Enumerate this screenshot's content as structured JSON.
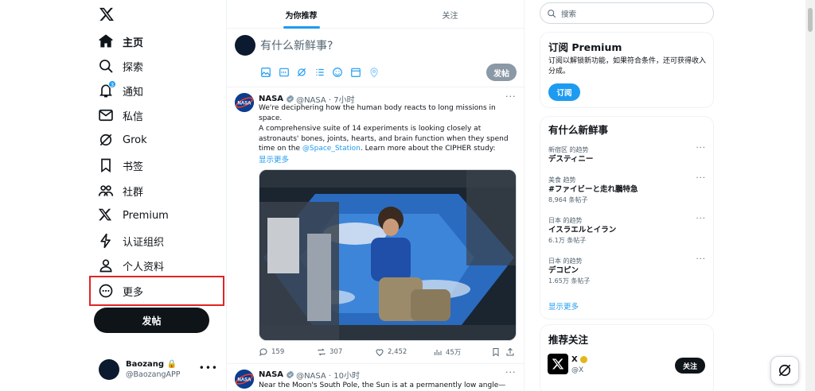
{
  "nav": {
    "items": [
      {
        "label": "主页",
        "icon": "home-icon"
      },
      {
        "label": "探索",
        "icon": "search-icon"
      },
      {
        "label": "通知",
        "icon": "bell-icon",
        "badge": "3"
      },
      {
        "label": "私信",
        "icon": "mail-icon"
      },
      {
        "label": "Grok",
        "icon": "grok-icon"
      },
      {
        "label": "书签",
        "icon": "bookmark-icon"
      },
      {
        "label": "社群",
        "icon": "communities-icon"
      },
      {
        "label": "Premium",
        "icon": "x-logo-icon"
      },
      {
        "label": "认证组织",
        "icon": "lightning-icon"
      },
      {
        "label": "个人资料",
        "icon": "profile-icon"
      },
      {
        "label": "更多",
        "icon": "more-circle-icon"
      }
    ],
    "post_button": "发帖",
    "account": {
      "name": "Baozang",
      "handle": "@BaozangAPP"
    }
  },
  "main": {
    "tabs": [
      "为你推荐",
      "关注"
    ],
    "composer": {
      "placeholder": "有什么新鲜事?",
      "post_button": "发帖"
    },
    "tweets": [
      {
        "name": "NASA",
        "meta": "@NASA · 7小时",
        "text1": "We're deciphering how the human body reacts to long missions in space.",
        "text2": "A comprehensive suite of 14 experiments is looking closely at astronauts' bones, joints, hearts, and brain function when they spend time on the",
        "mention": "@Space_Station",
        "text3": ". Learn more about the CIPHER study:",
        "show_more": "显示更多",
        "replies": "159",
        "reposts": "307",
        "likes": "2,452",
        "views": "45万"
      },
      {
        "name": "NASA",
        "meta": "@NASA · 10小时",
        "text1": "Near the Moon's South Pole, the Sun is at a permanently low angle—and"
      }
    ]
  },
  "right": {
    "search_placeholder": "搜索",
    "premium": {
      "title": "订阅 Premium",
      "desc": "订阅以解锁新功能，如果符合条件，还可获得收入分成。",
      "button": "订阅"
    },
    "trends": {
      "title": "有什么新鲜事",
      "items": [
        {
          "category": "新宿区 的趋势",
          "name": "デスティニー",
          "count": ""
        },
        {
          "category": "美食 趋势",
          "name": "#ファイビーと走れ鵬特急",
          "count": "8,964 条帖子"
        },
        {
          "category": "日本 的趋势",
          "name": "イスラエルとイラン",
          "count": "6.1万 条帖子"
        },
        {
          "category": "日本 的趋势",
          "name": "デコピン",
          "count": "1.65万 条帖子"
        }
      ],
      "show_more": "显示更多"
    },
    "who_to_follow": {
      "title": "推荐关注",
      "items": [
        {
          "name": "X",
          "handle": "@X",
          "button": "关注"
        }
      ]
    }
  },
  "colors": {
    "accent": "#1d9bf0",
    "text": "#0f1419",
    "muted": "#536471",
    "highlight_box": "#e02424"
  }
}
